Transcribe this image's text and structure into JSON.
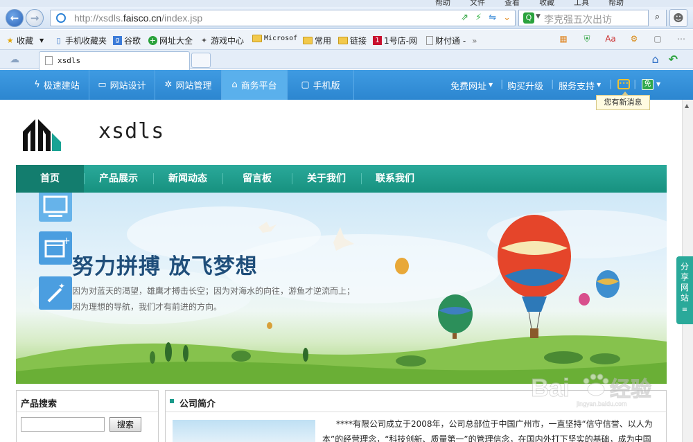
{
  "browser": {
    "menu": [
      "帮助",
      "文件",
      "查看",
      "收藏",
      "工具",
      "帮助"
    ],
    "address": {
      "prefix": "http://xsdls.",
      "domain": "faisco.cn",
      "suffix": "/index.jsp"
    },
    "search_placeholder": "李克强五次出访",
    "favorites": [
      {
        "label": "收藏",
        "icon": "star-icon"
      },
      {
        "label": "手机收藏夹",
        "icon": "phone-icon"
      },
      {
        "label": "谷歌",
        "icon": "google-icon"
      },
      {
        "label": "网址大全",
        "icon": "plus-circle-icon"
      },
      {
        "label": "游戏中心",
        "icon": "gamepad-icon"
      },
      {
        "label": "Microsof",
        "icon": "folder-icon"
      },
      {
        "label": "常用",
        "icon": "folder-icon"
      },
      {
        "label": "链接",
        "icon": "folder-icon"
      },
      {
        "label": "1号店-网",
        "icon": "yhd-icon"
      },
      {
        "label": "财付通 -",
        "icon": "page-icon"
      }
    ],
    "tab_title": "xsdls"
  },
  "adminbar": {
    "left": [
      "极速建站",
      "网站设计",
      "网站管理",
      "商务平台",
      "手机版"
    ],
    "right": [
      "免费网址",
      "购买升级",
      "服务支持"
    ],
    "badge": "免",
    "tooltip": "您有新消息"
  },
  "site": {
    "title": "xsdls",
    "nav": [
      "首页",
      "产品展示",
      "新闻动态",
      "留言板",
      "关于我们",
      "联系我们"
    ],
    "banner": {
      "slogan": "努力拼搏 放飞梦想",
      "line1": "因为对蓝天的渴望，雄鹰才搏击长空；因为对海水的向往，游鱼才逆流而上；",
      "line2": "因为理想的导航，我们才有前进的方向。"
    },
    "share": [
      "分",
      "享",
      "网",
      "站"
    ],
    "search_panel": {
      "title": "产品搜索",
      "button": "搜索"
    },
    "intro_panel": {
      "title": "公司简介",
      "text1": "****有限公司成立于2008年，公司总部位于中国广州市，一直坚持“信守信誉、以人为",
      "text2": "本”的经营理念，“科技创新、质量第一”的管理信念，在国内外打下坚实的基础，成为中国"
    }
  },
  "watermark": {
    "brand": "Bai",
    "cn": "经验",
    "sub": "jingyan.baidu.com"
  },
  "colors": {
    "admin_blue": "#2c86d0",
    "nav_teal": "#17917f",
    "slogan_blue": "#1f4e7a"
  }
}
